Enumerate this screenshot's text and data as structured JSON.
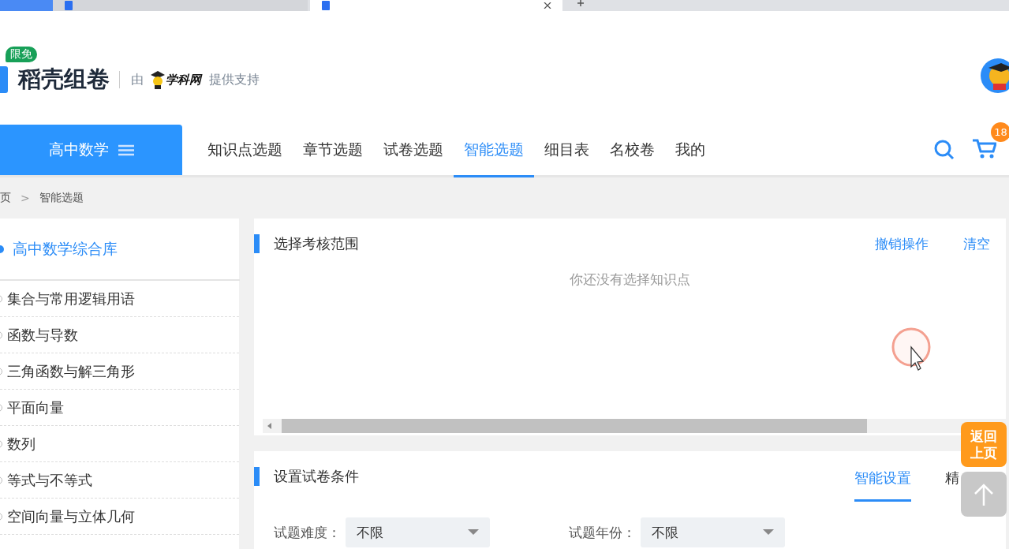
{
  "browser_tabs": [
    {
      "kind": "app",
      "selected": false
    },
    {
      "kind": "document",
      "selected": false
    },
    {
      "kind": "document",
      "selected": true
    }
  ],
  "header": {
    "badge": "限免",
    "brand": "稻壳组卷",
    "by": "由",
    "partner": "学科网",
    "support": "提供支持"
  },
  "nav": {
    "subject": "高中数学",
    "items": [
      {
        "label": "知识点选题",
        "selected": false
      },
      {
        "label": "章节选题",
        "selected": false
      },
      {
        "label": "试卷选题",
        "selected": false
      },
      {
        "label": "智能选题",
        "selected": true
      },
      {
        "label": "细目表",
        "selected": false
      },
      {
        "label": "名校卷",
        "selected": false
      },
      {
        "label": "我的",
        "selected": false
      }
    ],
    "cart_count": "18"
  },
  "breadcrumb": {
    "items": [
      "页",
      "智能选题"
    ],
    "separator": ">"
  },
  "sidebar": {
    "title": "高中数学综合库",
    "items": [
      {
        "label": "集合与常用逻辑用语",
        "selected": false
      },
      {
        "label": "函数与导数",
        "selected": false
      },
      {
        "label": "三角函数与解三角形",
        "selected": false
      },
      {
        "label": "平面向量",
        "selected": false
      },
      {
        "label": "数列",
        "selected": false
      },
      {
        "label": "等式与不等式",
        "selected": false
      },
      {
        "label": "空间向量与立体几何",
        "selected": false
      }
    ]
  },
  "scope_panel": {
    "title": "选择考核范围",
    "actions": [
      "撤销操作",
      "清空"
    ],
    "empty_message": "你还没有选择知识点"
  },
  "conditions_panel": {
    "title": "设置试卷条件",
    "tabs": [
      {
        "label": "智能设置",
        "selected": true
      },
      {
        "label": "精",
        "selected": false
      }
    ],
    "fields": [
      {
        "label": "试题难度：",
        "value": "不限"
      },
      {
        "label": "试题年份：",
        "value": "不限"
      }
    ]
  },
  "float_buttons": {
    "back": "返回上页"
  }
}
